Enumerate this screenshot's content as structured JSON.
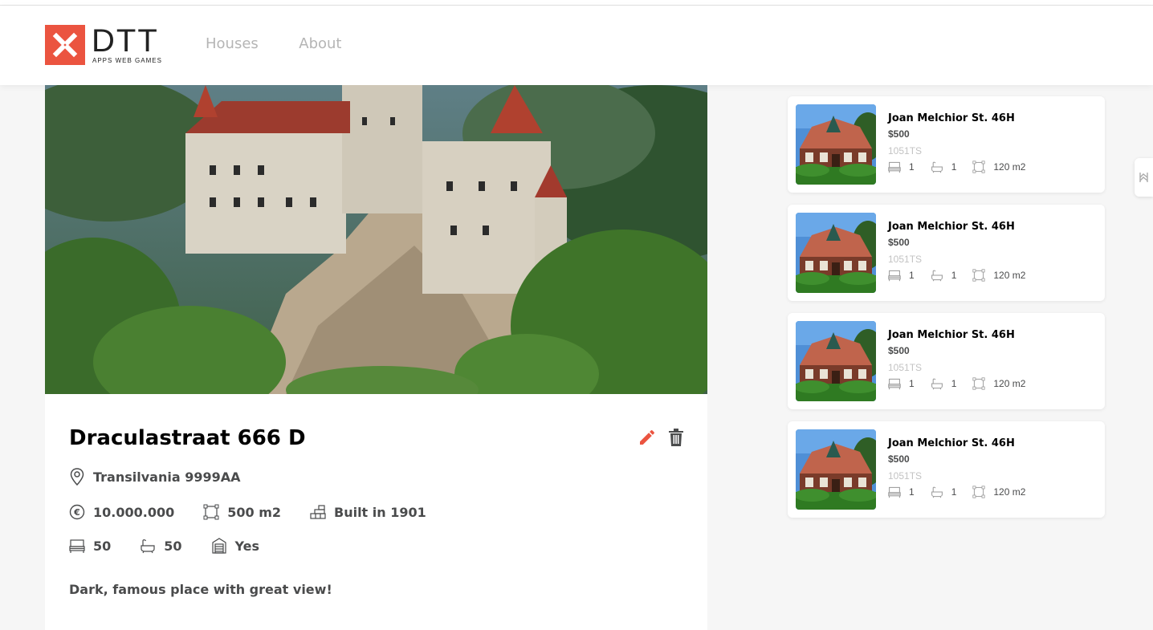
{
  "nav": {
    "houses": "Houses",
    "about": "About"
  },
  "logo": {
    "word": "DTT",
    "tagline": "APPS WEB GAMES"
  },
  "house": {
    "title": "Draculastraat 666 D",
    "location": "Transilvania 9999AA",
    "price": "10.000.000",
    "size": "500 m2",
    "built": "Built in 1901",
    "bedrooms": "50",
    "bathrooms": "50",
    "garage": "Yes",
    "description": "Dark, famous place with great view!"
  },
  "recommended": [
    {
      "address": "Joan Melchior St. 46H",
      "price": "$500",
      "zip": "1051TS",
      "bedrooms": "1",
      "bathrooms": "1",
      "size": "120 m2"
    },
    {
      "address": "Joan Melchior St. 46H",
      "price": "$500",
      "zip": "1051TS",
      "bedrooms": "1",
      "bathrooms": "1",
      "size": "120 m2"
    },
    {
      "address": "Joan Melchior St. 46H",
      "price": "$500",
      "zip": "1051TS",
      "bedrooms": "1",
      "bathrooms": "1",
      "size": "120 m2"
    },
    {
      "address": "Joan Melchior St. 46H",
      "price": "$500",
      "zip": "1051TS",
      "bedrooms": "1",
      "bathrooms": "1",
      "size": "120 m2"
    }
  ],
  "colors": {
    "accent": "#eb5440",
    "text": "#4a4b4c",
    "muted": "#c3c3c3",
    "background": "#f6f6f6"
  },
  "icons": {
    "location": "location-pin-icon",
    "price": "euro-icon",
    "size": "size-icon",
    "built": "construction-icon",
    "bedrooms": "bed-icon",
    "bathrooms": "bath-icon",
    "garage": "garage-icon",
    "edit": "pencil-icon",
    "delete": "trash-icon"
  }
}
